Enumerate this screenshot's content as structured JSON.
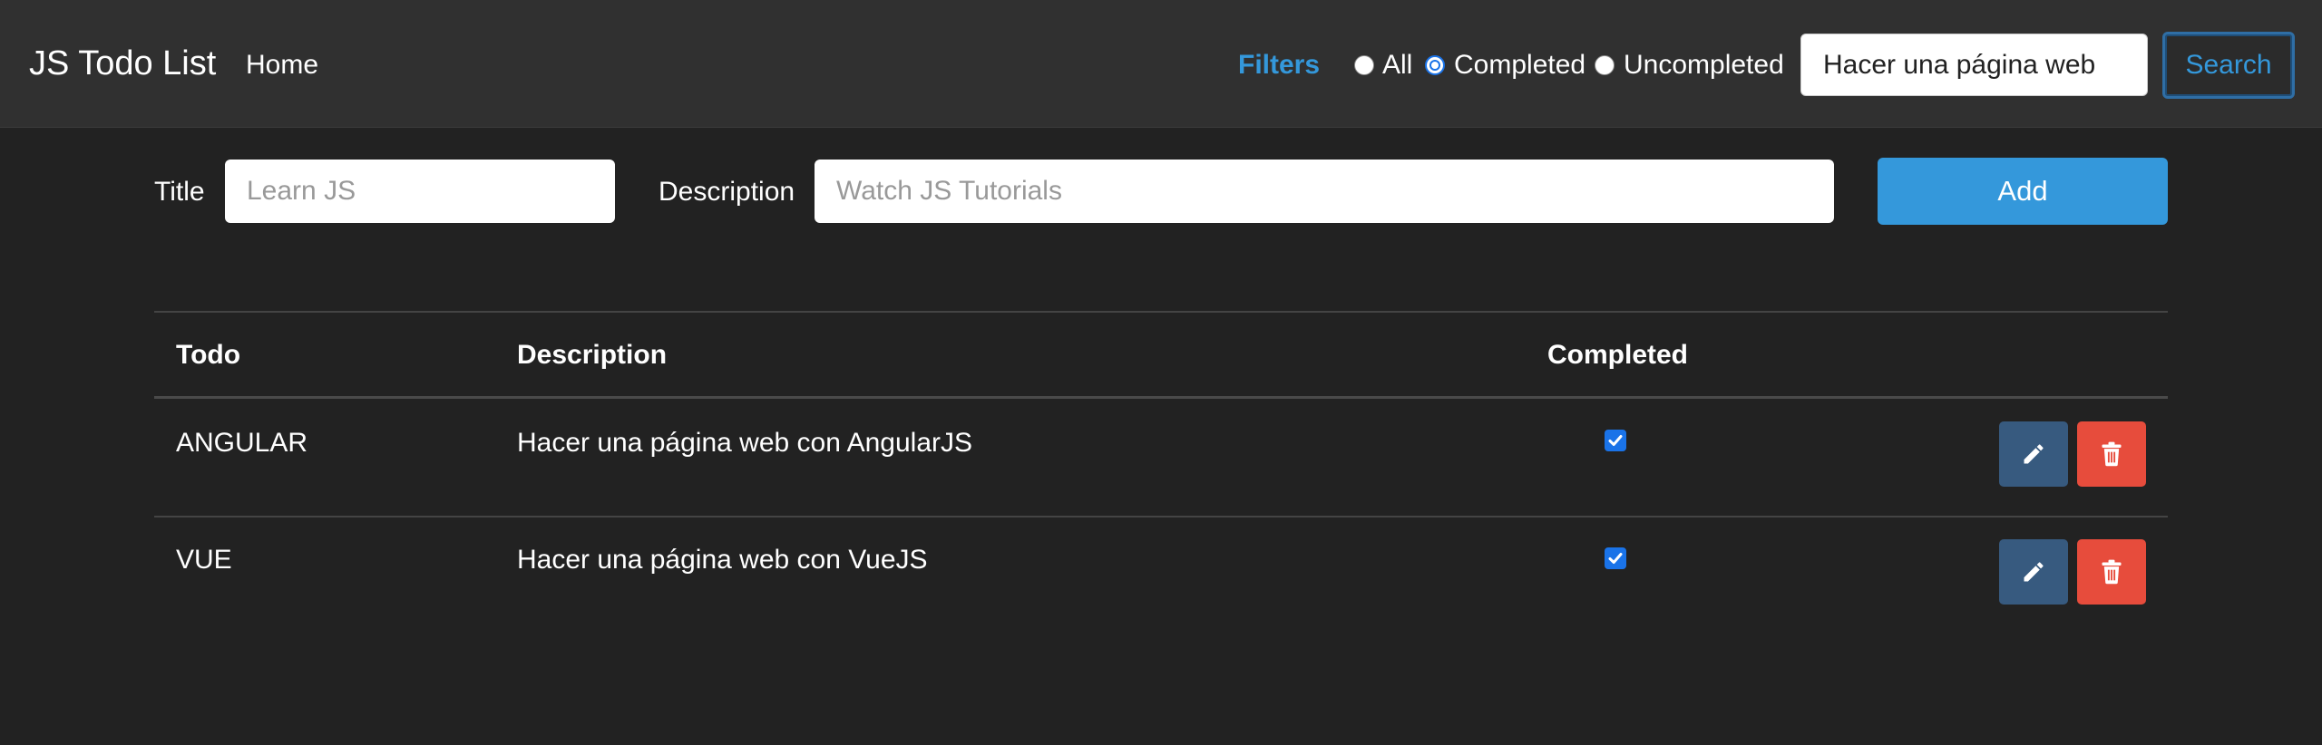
{
  "navbar": {
    "brand": "JS Todo List",
    "home": "Home",
    "filters_label": "Filters",
    "radios": [
      {
        "label": "All",
        "checked": false
      },
      {
        "label": "Completed",
        "checked": true
      },
      {
        "label": "Uncompleted",
        "checked": false
      }
    ],
    "search_value": "Hacer una página web",
    "search_button": "Search"
  },
  "form": {
    "title_label": "Title",
    "title_placeholder": "Learn JS",
    "description_label": "Description",
    "description_placeholder": "Watch JS Tutorials",
    "add_button": "Add"
  },
  "table": {
    "headers": [
      "Todo",
      "Description",
      "Completed"
    ],
    "rows": [
      {
        "todo": "ANGULAR",
        "description": "Hacer una página web con AngularJS",
        "completed": true
      },
      {
        "todo": "VUE",
        "description": "Hacer una página web con VueJS",
        "completed": true
      }
    ]
  },
  "colors": {
    "accent": "#3498db",
    "edit_button": "#375a7f",
    "delete_button": "#e74c3c",
    "background": "#222222",
    "navbar": "#303030"
  },
  "icons": {
    "edit": "pencil-icon",
    "delete": "trash-icon",
    "checkbox": "check-icon"
  }
}
